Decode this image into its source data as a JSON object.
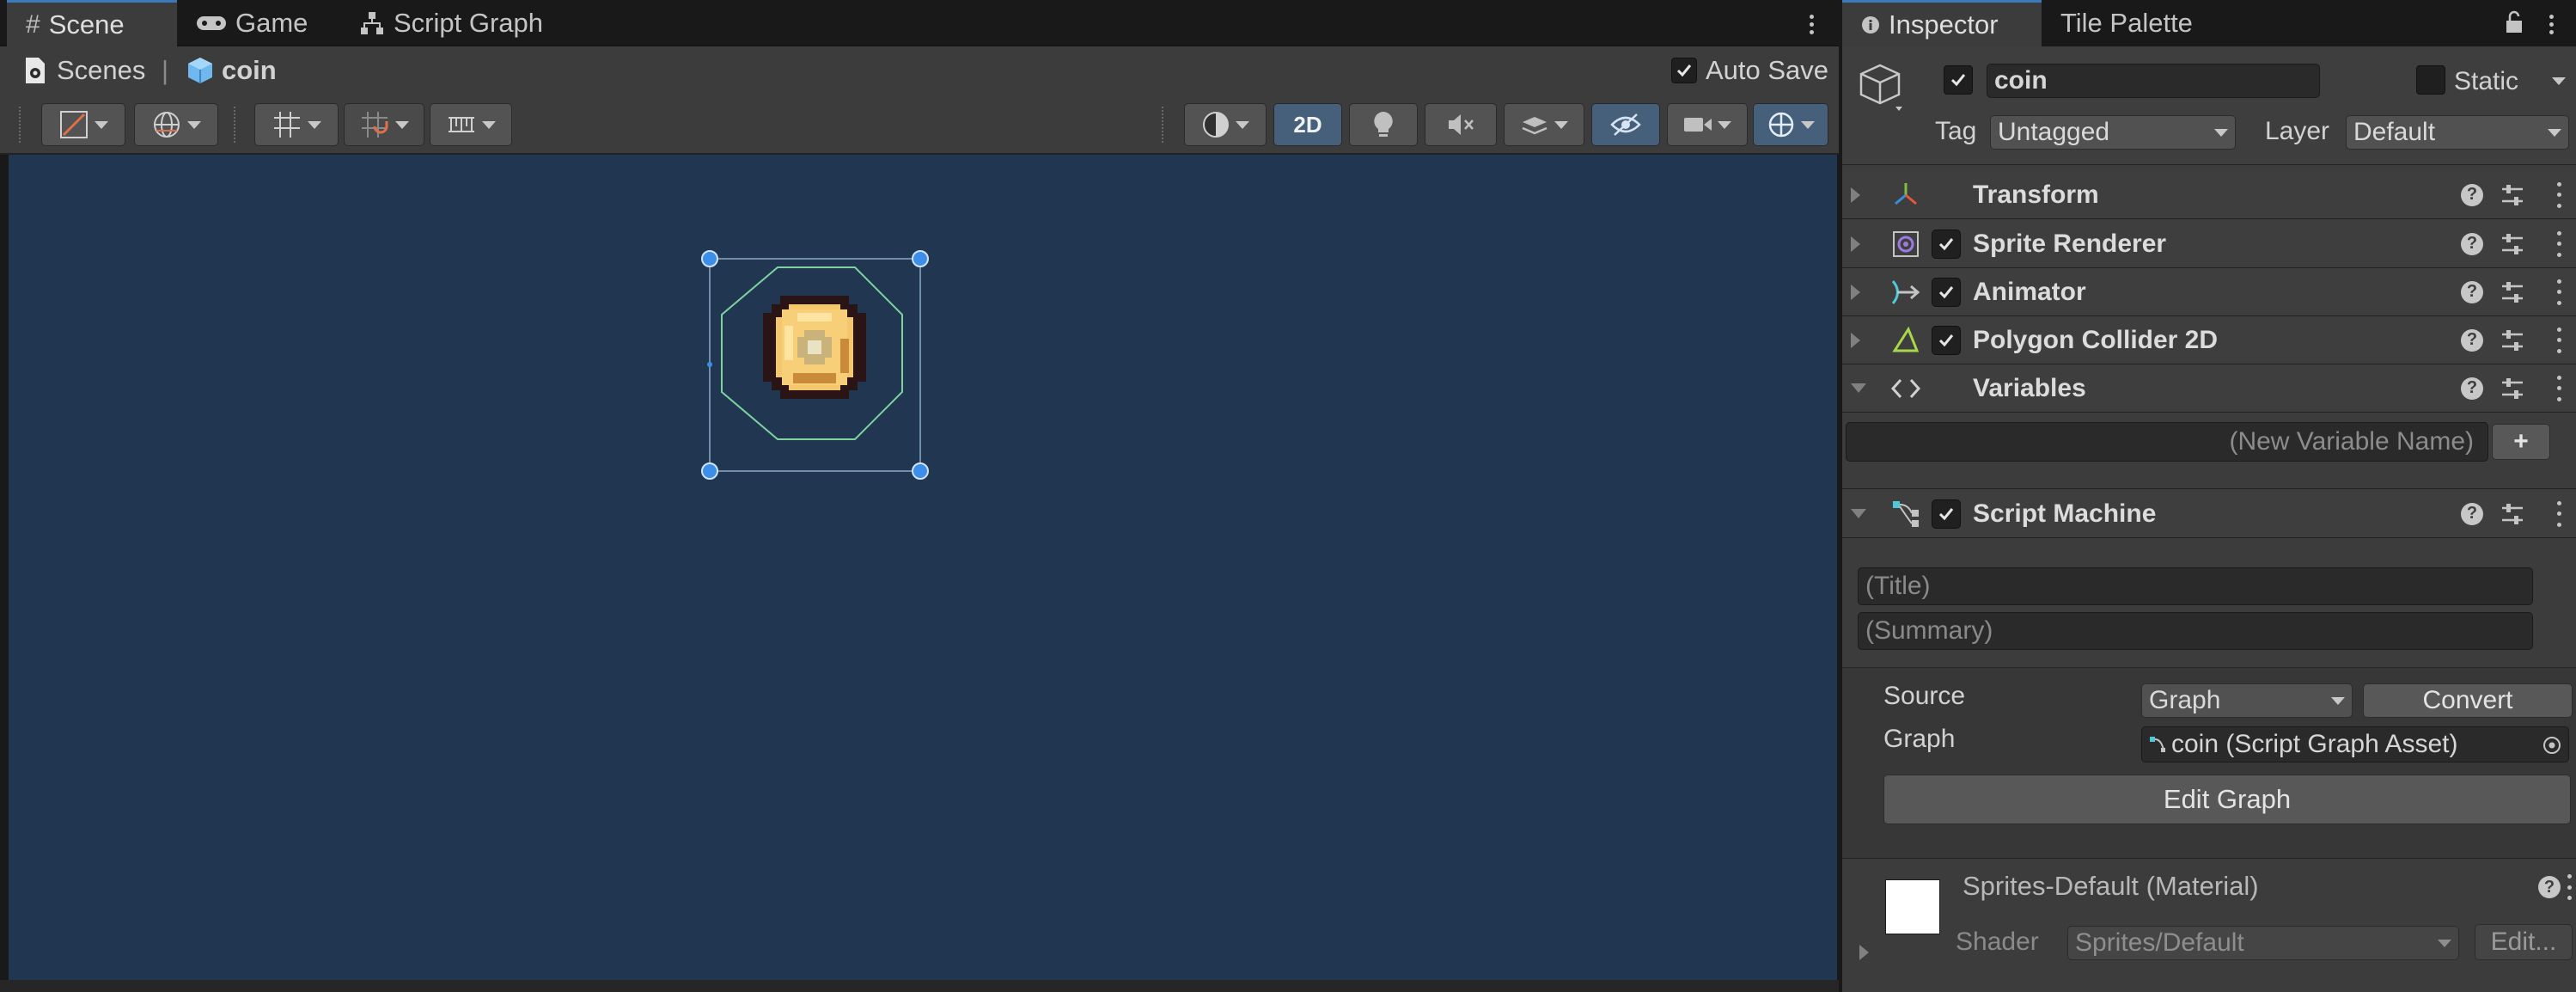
{
  "scene_panel": {
    "tabs": [
      {
        "label": "Scene",
        "icon": "hash-icon"
      },
      {
        "label": "Game",
        "icon": "gamepad-icon"
      },
      {
        "label": "Script Graph",
        "icon": "hierarchy-icon"
      }
    ],
    "breadcrumb": {
      "root": "Scenes",
      "separator": "|",
      "current": "coin"
    },
    "auto_save_label": "Auto Save",
    "toolbar": {
      "mode_2d_label": "2D"
    }
  },
  "inspector": {
    "tabs": [
      {
        "label": "Inspector",
        "icon": "info-icon"
      },
      {
        "label": "Tile Palette",
        "icon": ""
      }
    ],
    "object_name": "coin",
    "static_label": "Static",
    "tag_label": "Tag",
    "tag_value": "Untagged",
    "layer_label": "Layer",
    "layer_value": "Default",
    "components": [
      {
        "name": "Transform",
        "icon": "transform-icon"
      },
      {
        "name": "Sprite Renderer",
        "icon": "sprite-renderer-icon"
      },
      {
        "name": "Animator",
        "icon": "animator-icon"
      },
      {
        "name": "Polygon Collider 2D",
        "icon": "polygon-collider-icon"
      },
      {
        "name": "Variables",
        "icon": "code-brackets-icon"
      },
      {
        "name": "Script Machine",
        "icon": "script-machine-icon"
      }
    ],
    "variables": {
      "new_variable_placeholder": "(New Variable Name)",
      "add_label": "+"
    },
    "script_machine": {
      "title_placeholder": "(Title)",
      "summary_placeholder": "(Summary)",
      "source_label": "Source",
      "source_value": "Graph",
      "convert_label": "Convert",
      "graph_label": "Graph",
      "graph_value": "coin (Script Graph Asset)",
      "edit_graph_label": "Edit Graph"
    },
    "material": {
      "name": "Sprites-Default (Material)",
      "shader_label": "Shader",
      "shader_value": "Sprites/Default",
      "edit_label": "Edit..."
    }
  },
  "colors": {
    "scene_background": "#213751",
    "panel": "#3c3c3c",
    "accent": "#3a79bb",
    "collider_outline": "#7ed2a0",
    "handle": "#3d8ee8"
  }
}
